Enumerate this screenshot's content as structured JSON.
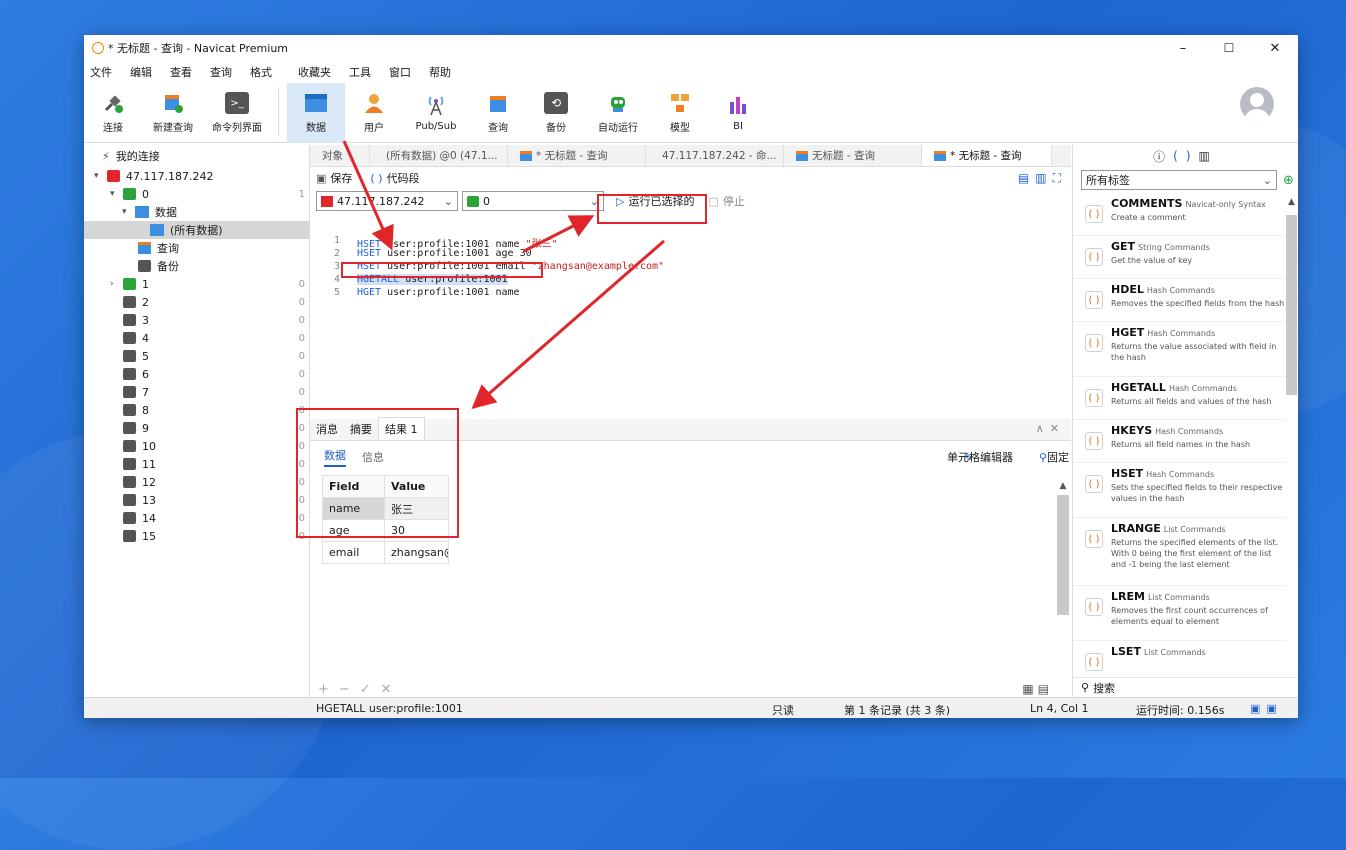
{
  "window": {
    "title": "* 无标题 - 查询 - Navicat Premium",
    "minimize": "–",
    "maximize": "☐",
    "close": "✕"
  },
  "menu": [
    "文件",
    "编辑",
    "查看",
    "查询",
    "格式",
    "收藏夹",
    "工具",
    "窗口",
    "帮助"
  ],
  "toolbar": {
    "left": [
      {
        "label": "连接",
        "icon": "plug-icon"
      },
      {
        "label": "新建查询",
        "icon": "new-query-icon"
      },
      {
        "label": "命令列界面",
        "icon": "terminal-icon"
      }
    ],
    "main": [
      {
        "label": "数据",
        "icon": "table-icon",
        "active": true
      },
      {
        "label": "用户",
        "icon": "user-icon"
      },
      {
        "label": "Pub/Sub",
        "icon": "broadcast-icon"
      },
      {
        "label": "查询",
        "icon": "query-icon"
      },
      {
        "label": "备份",
        "icon": "backup-icon"
      },
      {
        "label": "自动运行",
        "icon": "robot-icon"
      },
      {
        "label": "模型",
        "icon": "model-icon"
      },
      {
        "label": "BI",
        "icon": "bi-icon"
      }
    ]
  },
  "left_panel": {
    "header": "我的连接",
    "connection": "47.117.187.242",
    "db0": {
      "name": "0",
      "count": "1"
    },
    "data_node": "数据",
    "all_data": "(所有数据)",
    "query_node": "查询",
    "backup_node": "备份",
    "dbs": [
      {
        "name": "1",
        "count": "0"
      },
      {
        "name": "2",
        "count": "0"
      },
      {
        "name": "3",
        "count": "0"
      },
      {
        "name": "4",
        "count": "0"
      },
      {
        "name": "5",
        "count": "0"
      },
      {
        "name": "6",
        "count": "0"
      },
      {
        "name": "7",
        "count": "0"
      },
      {
        "name": "8",
        "count": "0"
      },
      {
        "name": "9",
        "count": "0"
      },
      {
        "name": "10",
        "count": "0"
      },
      {
        "name": "11",
        "count": "0"
      },
      {
        "name": "12",
        "count": "0"
      },
      {
        "name": "13",
        "count": "0"
      },
      {
        "name": "14",
        "count": "0"
      },
      {
        "name": "15",
        "count": "0"
      }
    ],
    "search": "搜索"
  },
  "tabs": [
    "对象",
    "(所有数据) @0 (47.1...",
    "* 无标题 - 查询",
    "47.117.187.242 - 命...",
    "无标题 - 查询",
    "* 无标题 - 查询"
  ],
  "query_toolbar": {
    "save": "保存",
    "snippet": "代码段"
  },
  "selectors": {
    "connection": "47.117.187.242",
    "database": "0",
    "run_selected": "运行已选择的",
    "stop": "停止"
  },
  "editor": {
    "line_numbers": [
      "1",
      "2",
      "3",
      "4",
      "5"
    ],
    "lines": [
      {
        "cmd": "HSET",
        "args": "user:profile:1001 name ",
        "str": "\"张三\""
      },
      {
        "cmd": "HSET",
        "args": "user:profile:1001 age 30",
        "str": ""
      },
      {
        "cmd": "HSET",
        "args": "user:profile:1001 email ",
        "str": "\"zhangsan@example.com\""
      },
      {
        "cmd": "HGETALL",
        "args": "user:profile:1001",
        "str": ""
      },
      {
        "cmd": "HGET",
        "args": "user:profile:1001 name",
        "str": ""
      }
    ]
  },
  "result_tabs": [
    "消息",
    "摘要",
    "结果 1"
  ],
  "result_sub": {
    "data": "数据",
    "info": "信息",
    "cell_editor": "单元格编辑器",
    "pin": "固定"
  },
  "result_table": {
    "headers": [
      "Field",
      "Value"
    ],
    "rows": [
      [
        "name",
        "张三"
      ],
      [
        "age",
        "30"
      ],
      [
        "email",
        "zhangsan@example.com"
      ]
    ]
  },
  "right_panel": {
    "tag_filter": "所有标签",
    "snippets": [
      {
        "title": "COMMENTS",
        "cat": "Navicat-only Syntax",
        "desc": "Create a comment"
      },
      {
        "title": "GET",
        "cat": "String Commands",
        "desc": "Get the value of key"
      },
      {
        "title": "HDEL",
        "cat": "Hash Commands",
        "desc": "Removes the specified fields from the hash"
      },
      {
        "title": "HGET",
        "cat": "Hash Commands",
        "desc": "Returns the value associated with field in the hash"
      },
      {
        "title": "HGETALL",
        "cat": "Hash Commands",
        "desc": "Returns all fields and values of the hash"
      },
      {
        "title": "HKEYS",
        "cat": "Hash Commands",
        "desc": "Returns all field names in the hash"
      },
      {
        "title": "HSET",
        "cat": "Hash Commands",
        "desc": "Sets the specified fields to their respective values in the hash"
      },
      {
        "title": "LRANGE",
        "cat": "List Commands",
        "desc": "Returns the specified elements of the list. With 0 being the first element of the list and -1 being the last element"
      },
      {
        "title": "LREM",
        "cat": "List Commands",
        "desc": "Removes the first count occurrences of elements equal to element"
      },
      {
        "title": "LSET",
        "cat": "List Commands",
        "desc": ""
      }
    ],
    "search": "搜索"
  },
  "status": {
    "query": "HGETALL user:profile:1001",
    "readonly": "只读",
    "record": "第 1 条记录 (共 3 条)",
    "position": "Ln 4, Col 1",
    "runtime": "运行时间: 0.156s"
  },
  "colors": {
    "accent": "#1f5fd6",
    "annotation": "#e0262b",
    "keyword": "#1f5fd6",
    "string": "#c21f1f"
  }
}
